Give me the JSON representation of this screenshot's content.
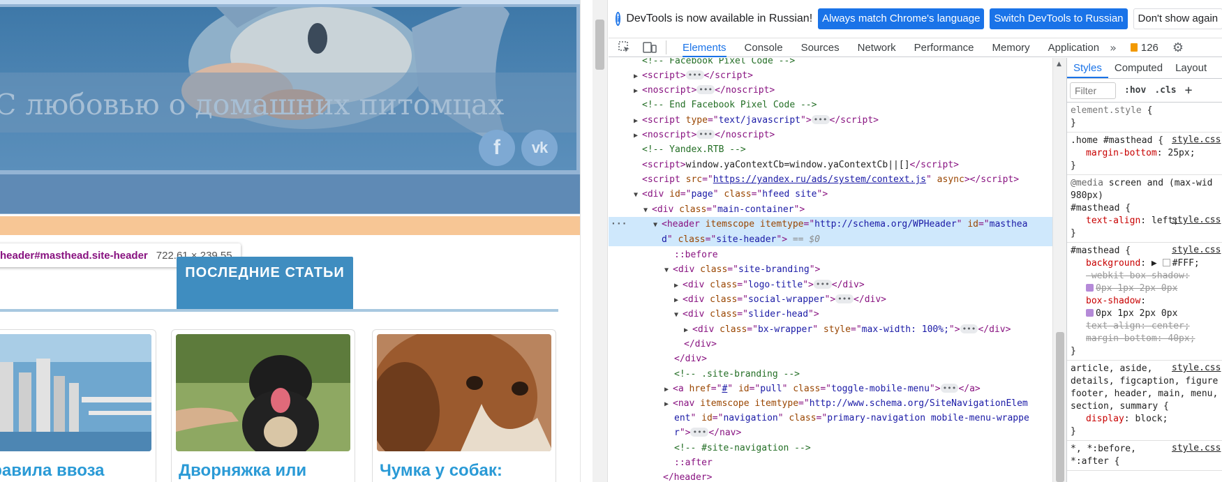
{
  "page": {
    "site_title": "С любовью о домашних питомцах",
    "social": {
      "facebook": "f",
      "vk": "vk"
    },
    "tooltip": {
      "selector": "header#masthead.site-header",
      "size": "722.61 × 239.55"
    },
    "tab_latest": "ПОСЛЕДНИЕ СТАТЬИ",
    "cards": [
      {
        "title": "Правила ввоза"
      },
      {
        "title": "Дворняжка или"
      },
      {
        "title": "Чумка у собак:"
      }
    ]
  },
  "infobar": {
    "text": "DevTools is now available in Russian!",
    "btn_match": "Always match Chrome's language",
    "btn_switch": "Switch DevTools to Russian",
    "btn_dismiss": "Don't show again"
  },
  "toolbar": {
    "tabs": [
      "Elements",
      "Console",
      "Sources",
      "Network",
      "Performance",
      "Memory",
      "Application"
    ],
    "more": "»",
    "issues_count": "126"
  },
  "dom": {
    "l0": "<!-- Facebook Pixel Code -->",
    "l7": "<!-- Yandex.RTB -->",
    "l8_text": "window.yaContextCb=window.yaContextCb||[]",
    "l9_src": "https://yandex.ru/ads/system/context.js",
    "l19": "<!-- .site-branding -->",
    "l24": "<!-- #site-navigation -->",
    "dollar0": "== $0"
  },
  "styles": {
    "tabs": [
      "Styles",
      "Computed",
      "Layout"
    ],
    "filter_placeholder": "Filter",
    "hov": ":hov",
    "cls": ".cls",
    "src": "style.css"
  }
}
